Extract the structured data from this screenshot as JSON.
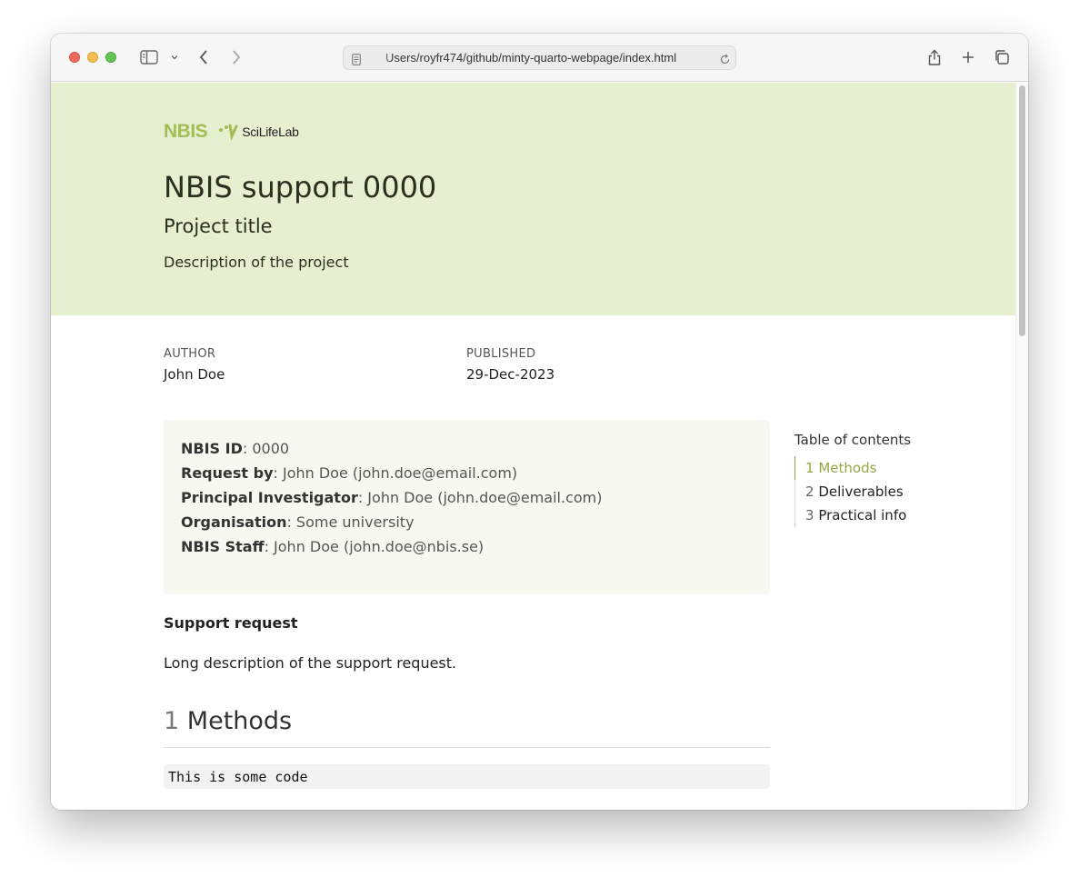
{
  "browser": {
    "url": "Users/royfr474/github/minty-quarto-webpage/index.html"
  },
  "banner": {
    "logo_nbis": "NBIS",
    "logo_scilifelab": "SciLifeLab",
    "title": "NBIS support 0000",
    "subtitle": "Project title",
    "description": "Description of the project",
    "background_color": "#e6efcf"
  },
  "meta": {
    "author_label": "AUTHOR",
    "author": "John Doe",
    "published_label": "PUBLISHED",
    "published": "29-Dec-2023"
  },
  "callout": {
    "rows": [
      {
        "label": "NBIS ID",
        "value": ": 0000"
      },
      {
        "label": "Request by",
        "value": ": John Doe (john.doe@email.com)"
      },
      {
        "label": "Principal Investigator",
        "value": ": John Doe (john.doe@email.com)"
      },
      {
        "label": "Organisation",
        "value": ": Some university"
      },
      {
        "label": "NBIS Staff",
        "value": ": John Doe (john.doe@nbis.se)"
      }
    ]
  },
  "content": {
    "support_heading": "Support request",
    "support_text": "Long description of the support request.",
    "section1_number": "1",
    "section1_title": "Methods",
    "code": "This is some code"
  },
  "toc": {
    "title": "Table of contents",
    "items": [
      {
        "number": "1",
        "label": "Methods",
        "active": true
      },
      {
        "number": "2",
        "label": "Deliverables",
        "active": false
      },
      {
        "number": "3",
        "label": "Practical info",
        "active": false
      }
    ],
    "accent_color": "#93a845"
  }
}
